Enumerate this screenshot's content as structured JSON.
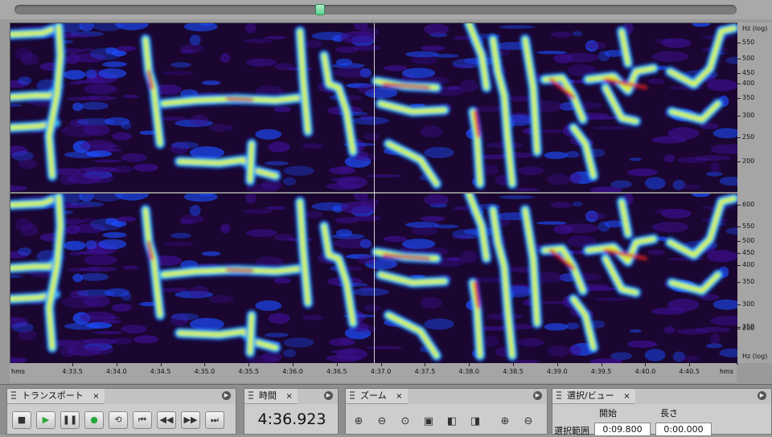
{
  "colors": {
    "background": "#1a0630",
    "low": "#3b0f8f",
    "mid_low": "#1c4dff",
    "mid": "#28d8ff",
    "mid_high": "#7dff4f",
    "high": "#ffe92a",
    "peak": "#d8231a"
  },
  "freq_ruler": {
    "unit_top": "Hz (log)",
    "unit_bottom": "Hz (log)",
    "channel1": [
      "550",
      "500",
      "450",
      "400",
      "350",
      "300",
      "250",
      "200"
    ],
    "channel2": [
      "600",
      "550",
      "500",
      "450",
      "400",
      "350",
      "300",
      "250",
      "200"
    ]
  },
  "time_ruler": {
    "unit_left": "hms",
    "unit_right": "hms",
    "labels": [
      "4:33.5",
      "4:34.0",
      "4:34.5",
      "4:35.0",
      "4:35.5",
      "4:36.0",
      "4:36.5",
      "4:37.0",
      "4:37.5",
      "4:38.0",
      "4:38.5",
      "4:39.0",
      "4:39.5",
      "4:40.0",
      "4:40.5"
    ]
  },
  "transport": {
    "title": "トランスポート",
    "close": "×",
    "buttons": [
      {
        "name": "stop-button",
        "icon": "stop-icon",
        "glyph": "■"
      },
      {
        "name": "play-button",
        "icon": "play-icon",
        "glyph": "▶"
      },
      {
        "name": "pause-button",
        "icon": "pause-icon",
        "glyph": "❚❚"
      },
      {
        "name": "play-from-cursor-button",
        "icon": "play-circle-icon",
        "glyph": "●"
      },
      {
        "name": "loop-button",
        "icon": "loop-icon",
        "glyph": "⟲"
      },
      {
        "name": "go-to-start-button",
        "icon": "skip-back-icon",
        "glyph": "⏮"
      },
      {
        "name": "rewind-button",
        "icon": "rewind-icon",
        "glyph": "◀◀"
      },
      {
        "name": "fast-forward-button",
        "icon": "fast-forward-icon",
        "glyph": "▶▶"
      },
      {
        "name": "go-to-end-button",
        "icon": "skip-forward-icon",
        "glyph": "⏭"
      }
    ]
  },
  "time": {
    "title": "時間",
    "close": "×",
    "display": "4:36.923"
  },
  "zoom": {
    "title": "ズーム",
    "close": "×",
    "buttons": [
      {
        "name": "zoom-in-horizontal-button",
        "icon": "zoom-in-horizontal-icon",
        "glyph": "⊕"
      },
      {
        "name": "zoom-out-horizontal-button",
        "icon": "zoom-out-horizontal-icon",
        "glyph": "⊖"
      },
      {
        "name": "zoom-out-full-button",
        "icon": "zoom-full-icon",
        "glyph": "⊙"
      },
      {
        "name": "zoom-selection-button",
        "icon": "zoom-selection-icon",
        "glyph": "▣"
      },
      {
        "name": "zoom-left-edge-button",
        "icon": "zoom-left-icon",
        "glyph": "◧"
      },
      {
        "name": "zoom-right-edge-button",
        "icon": "zoom-right-icon",
        "glyph": "◨"
      },
      {
        "name": "zoom-in-vertical-button",
        "icon": "zoom-in-vertical-icon",
        "glyph": "⊕"
      },
      {
        "name": "zoom-out-vertical-button",
        "icon": "zoom-out-vertical-icon",
        "glyph": "⊖"
      }
    ]
  },
  "selection": {
    "title": "選択/ビュー",
    "close": "×",
    "col_start": "開始",
    "col_length": "長さ",
    "row_label": "選択範囲",
    "start_value": "0:09.800",
    "length_value": "0:00.000"
  }
}
